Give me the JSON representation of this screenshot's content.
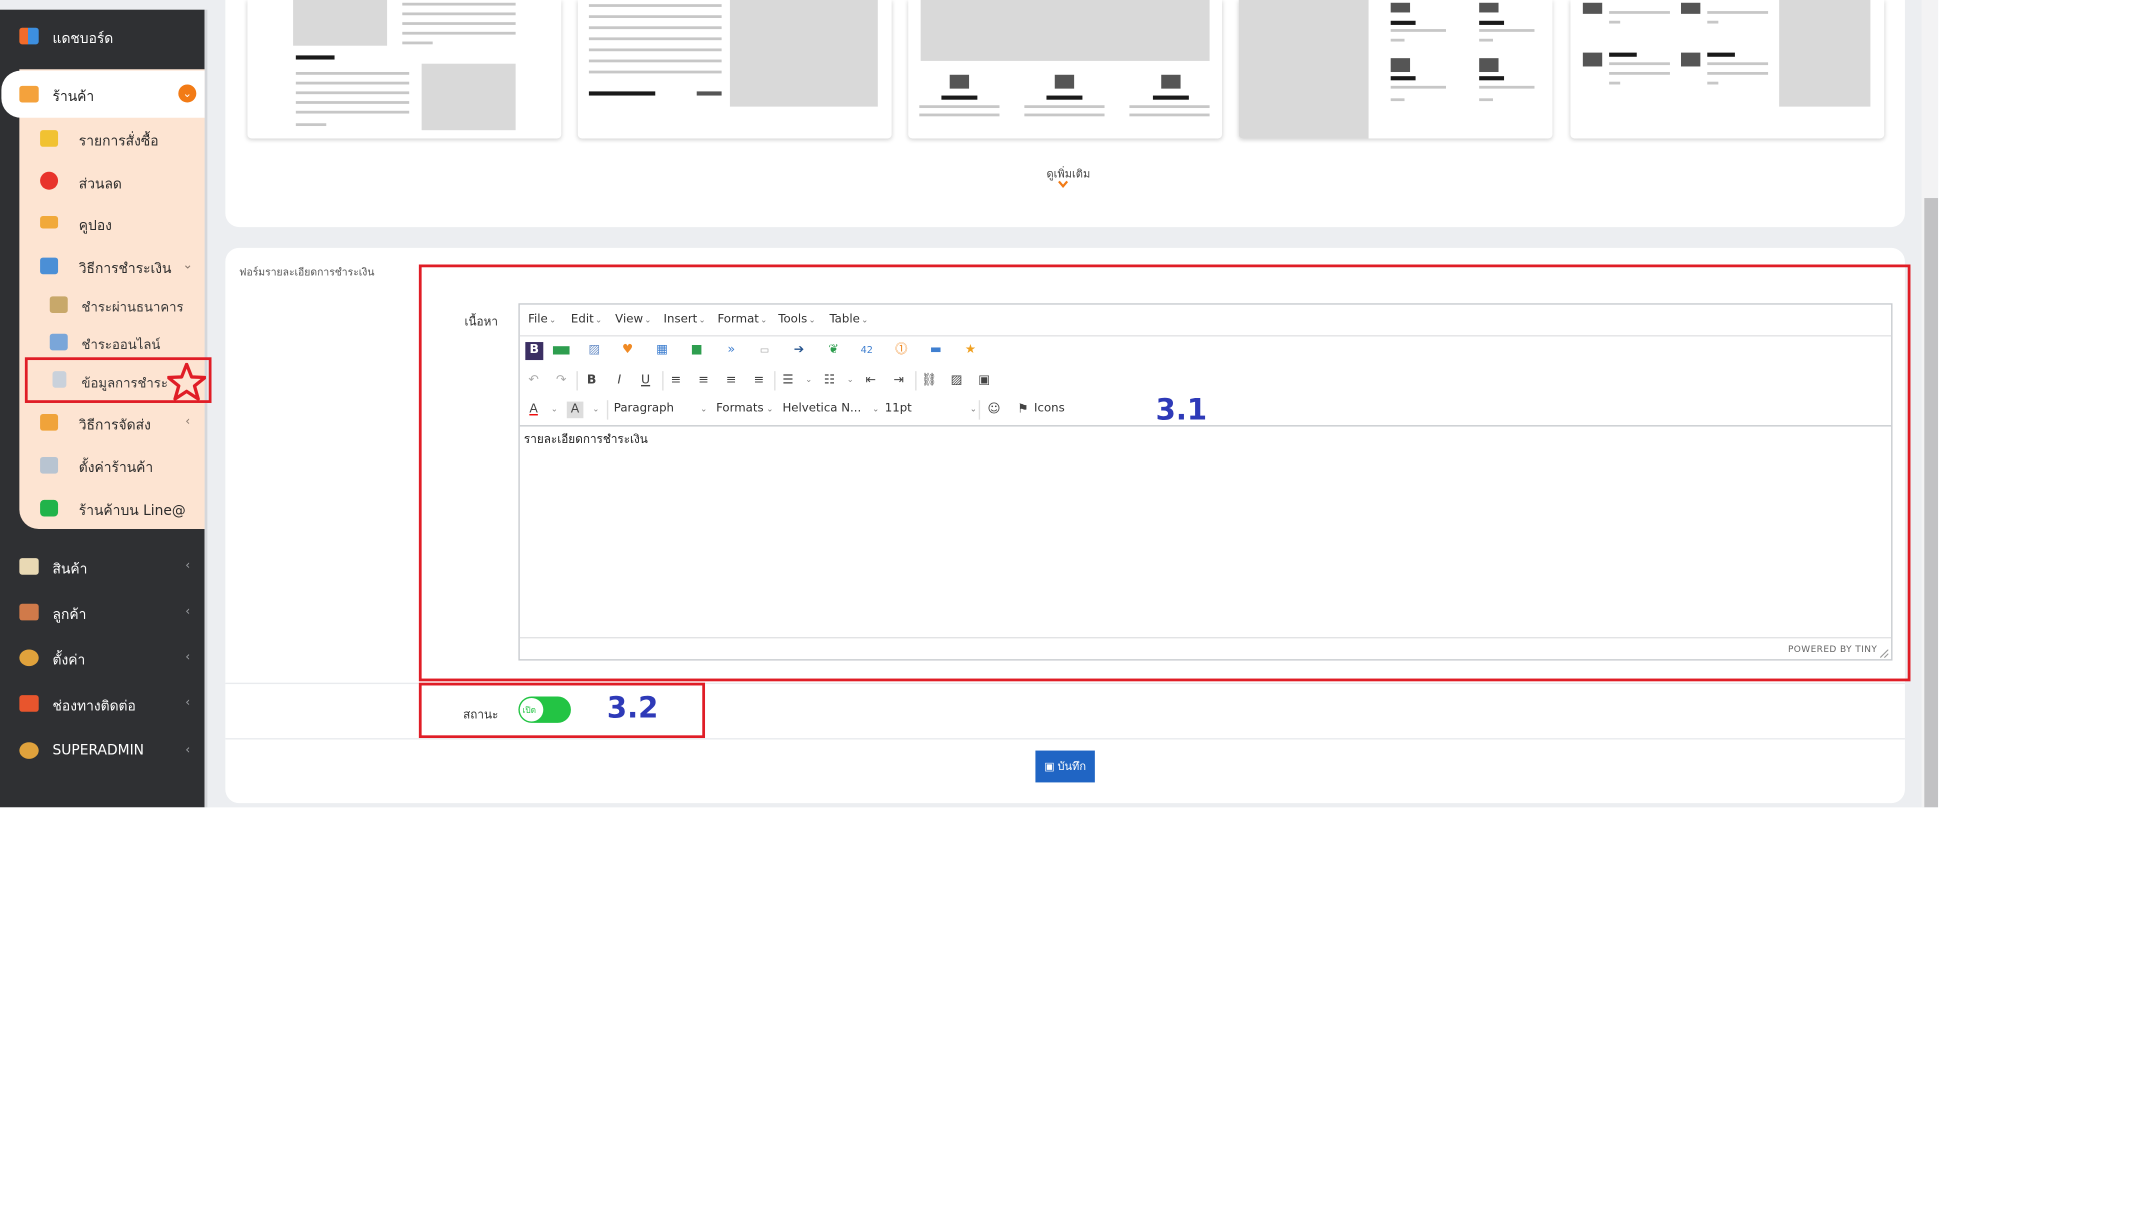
{
  "sidebar": {
    "dashboard": "แดชบอร์ด",
    "shop": "ร้านค้า",
    "shop_items": {
      "orders": "รายการสั่งซื้อ",
      "discount": "ส่วนลด",
      "coupon": "คูปอง",
      "payment_methods": "วิธีการชำระเงิน",
      "pay_bank": "ชำระผ่านธนาคาร",
      "pay_online": "ชำระออนไลน์",
      "payment_info": "ข้อมูลการชำระ",
      "shipping": "วิธีการจัดส่ง",
      "shop_settings": "ตั้งค่าร้านค้า",
      "line_shop": "ร้านค้าบน Line@"
    },
    "products": "สินค้า",
    "customers": "ลูกค้า",
    "settings": "ตั้งค่า",
    "contact": "ช่องทางติดต่อ",
    "superadmin": "SUPERADMIN"
  },
  "templates": {
    "more_label": "ดูเพิ่มเติม"
  },
  "form": {
    "title": "ฟอร์มรายละเอียดการชำระเงิน",
    "content_label": "เนื้อหา",
    "editor": {
      "menus": [
        "File",
        "Edit",
        "View",
        "Insert",
        "Format",
        "Tools",
        "Table"
      ],
      "paragraph": "Paragraph",
      "formats": "Formats",
      "font": "Helvetica N...",
      "size": "11pt",
      "icons_label": "Icons",
      "content": "รายละเอียดการชำระเงิน",
      "powered": "POWERED BY TINY"
    },
    "status_label": "สถานะ",
    "toggle_on": "เปิด",
    "save": "บันทึก"
  },
  "annotations": {
    "a1": "3.1",
    "a2": "3.2"
  },
  "colors": {
    "accent_red": "#e01d26",
    "annot_blue": "#2e3ab8",
    "toggle_green": "#23c444",
    "save_blue": "#2065c4",
    "badge_orange": "#f27b16"
  }
}
